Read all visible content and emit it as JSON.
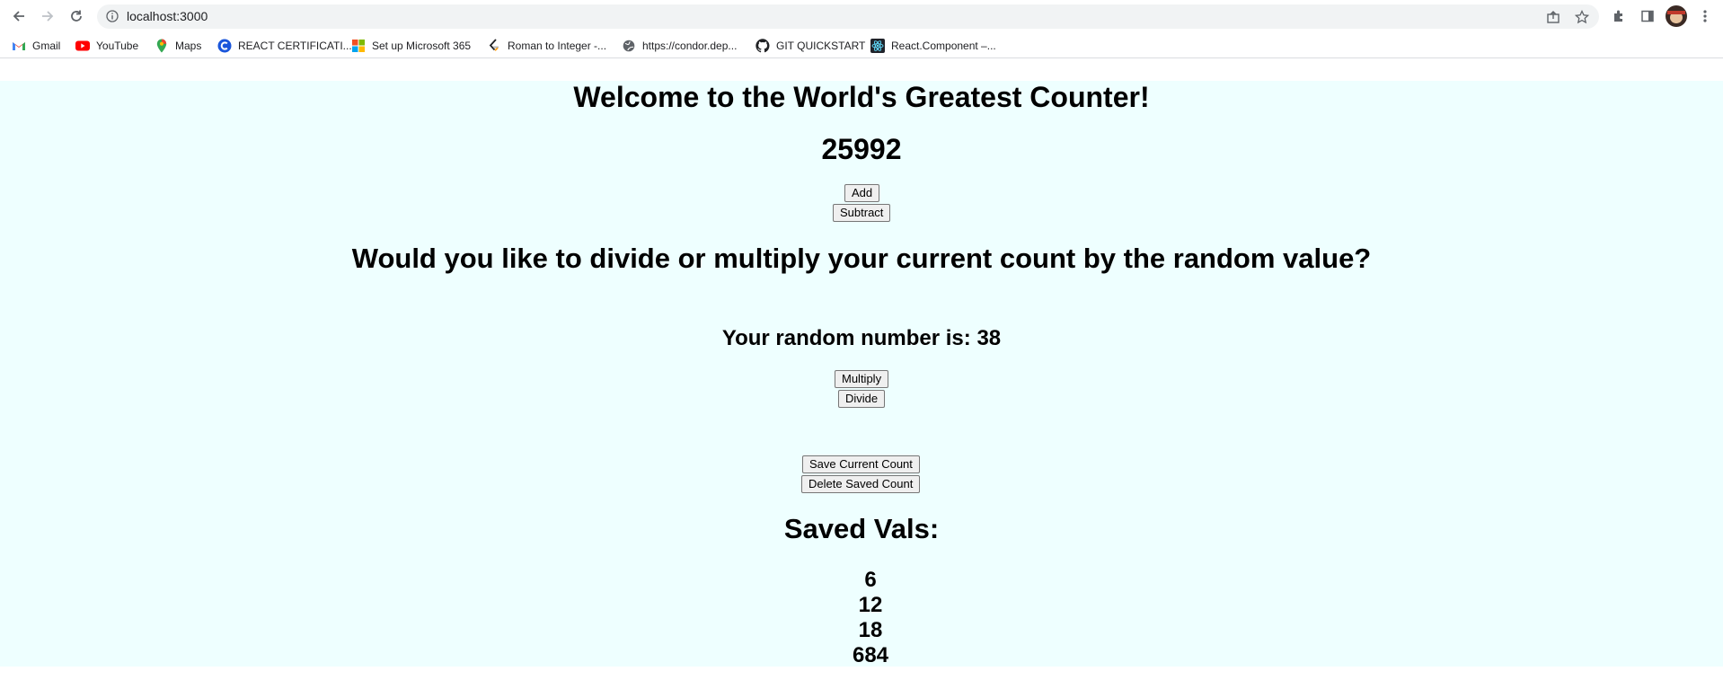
{
  "browser": {
    "url": "localhost:3000",
    "bookmarks": [
      {
        "label": "Gmail",
        "icon": "gmail-icon"
      },
      {
        "label": "YouTube",
        "icon": "youtube-icon"
      },
      {
        "label": "Maps",
        "icon": "maps-icon"
      },
      {
        "label": "REACT CERTIFICATI...",
        "icon": "react-cert-icon"
      },
      {
        "label": "Set up Microsoft 365",
        "icon": "microsoft-icon"
      },
      {
        "label": "Roman to Integer -...",
        "icon": "leetcode-icon"
      },
      {
        "label": "https://condor.dep...",
        "icon": "globe-icon"
      },
      {
        "label": "GIT QUICKSTART",
        "icon": "github-icon"
      },
      {
        "label": "React.Component –...",
        "icon": "react-icon"
      }
    ]
  },
  "app": {
    "title": "Welcome to the World's Greatest Counter!",
    "count": "25992",
    "add_label": "Add",
    "subtract_label": "Subtract",
    "question": "Would you like to divide or multiply your current count by the random value?",
    "random_text": "Your random number is: 38",
    "multiply_label": "Multiply",
    "divide_label": "Divide",
    "save_label": "Save Current Count",
    "delete_label": "Delete Saved Count",
    "saved_title": "Saved Vals:",
    "saved_values": [
      "6",
      "12",
      "18",
      "684"
    ]
  },
  "colors": {
    "page_background": "#eeffff"
  }
}
